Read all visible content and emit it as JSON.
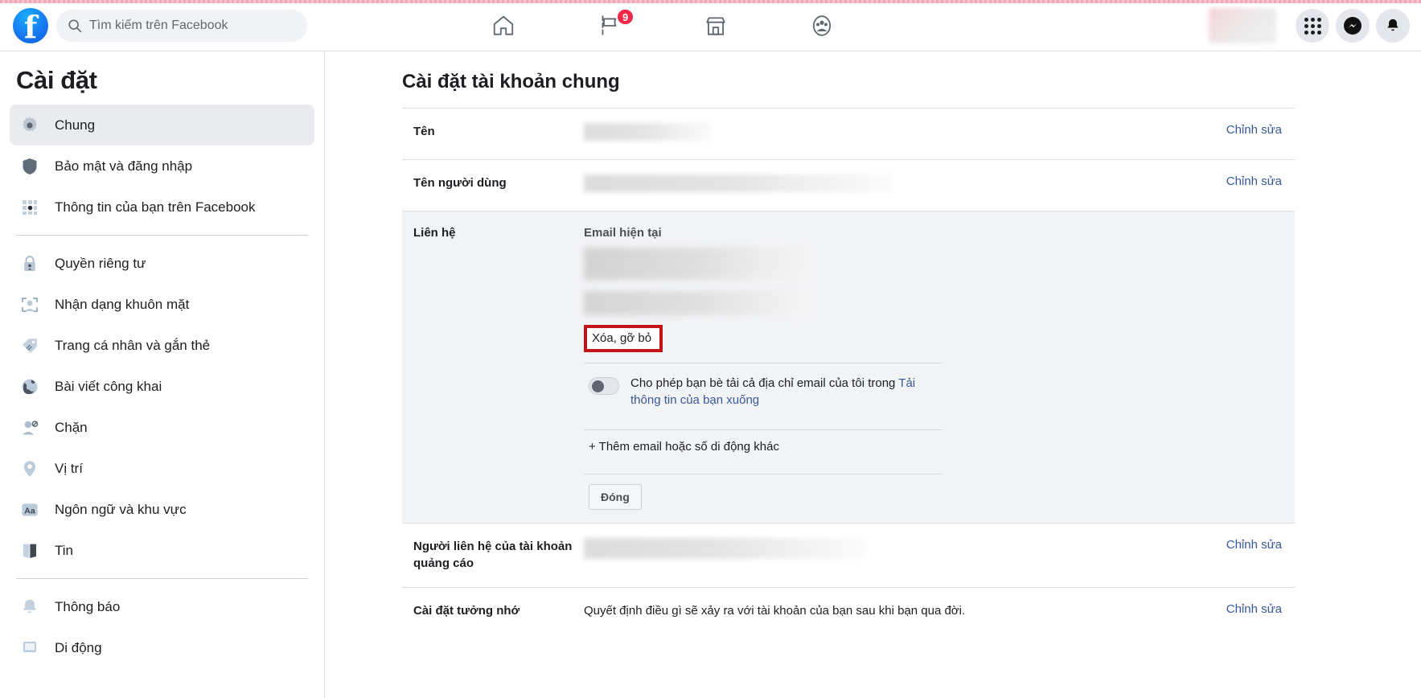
{
  "header": {
    "logo_icon": "facebook-logo-icon",
    "search": {
      "icon": "search-icon",
      "placeholder": "Tìm kiếm trên Facebook",
      "value": ""
    },
    "nav": [
      {
        "name": "home",
        "icon": "home-icon",
        "badge": ""
      },
      {
        "name": "pages",
        "icon": "flag-icon",
        "badge": "9"
      },
      {
        "name": "marketplace",
        "icon": "marketplace-icon",
        "badge": ""
      },
      {
        "name": "groups",
        "icon": "groups-icon",
        "badge": ""
      }
    ],
    "right": [
      {
        "name": "profile-chip",
        "icon": "profile-avatar-icon"
      },
      {
        "name": "menu",
        "icon": "grid-menu-icon"
      },
      {
        "name": "messenger",
        "icon": "messenger-icon"
      },
      {
        "name": "notifications",
        "icon": "bell-icon"
      }
    ]
  },
  "sidebar": {
    "title": "Cài đặt",
    "groups": [
      {
        "items": [
          {
            "label": "Chung",
            "icon": "gear-icon",
            "active": true
          },
          {
            "label": "Bảo mật và đăng nhập",
            "icon": "shield-icon",
            "active": false
          },
          {
            "label": "Thông tin của bạn trên Facebook",
            "icon": "grid-dots-icon",
            "active": false
          }
        ]
      },
      {
        "items": [
          {
            "label": "Quyền riêng tư",
            "icon": "lock-icon",
            "active": false
          },
          {
            "label": "Nhận dạng khuôn mặt",
            "icon": "face-recognition-icon",
            "active": false
          },
          {
            "label": "Trang cá nhân và gắn thẻ",
            "icon": "tag-icon",
            "active": false
          },
          {
            "label": "Bài viết công khai",
            "icon": "globe-icon",
            "active": false
          },
          {
            "label": "Chặn",
            "icon": "block-user-icon",
            "active": false
          },
          {
            "label": "Vị trí",
            "icon": "location-pin-icon",
            "active": false
          },
          {
            "label": "Ngôn ngữ và khu vực",
            "icon": "language-aa-icon",
            "active": false
          },
          {
            "label": "Tin",
            "icon": "stories-book-icon",
            "active": false
          }
        ]
      },
      {
        "items": [
          {
            "label": "Thông báo",
            "icon": "bell-icon",
            "active": false
          },
          {
            "label": "Di động",
            "icon": "mobile-icon",
            "active": false
          }
        ]
      }
    ]
  },
  "main": {
    "title": "Cài đặt tài khoản chung",
    "edit_label": "Chỉnh sửa",
    "rows": [
      {
        "label": "Tên",
        "value": "",
        "redacted": true,
        "edit": "Chỉnh sửa"
      },
      {
        "label": "Tên người dùng",
        "value": "",
        "redacted": true,
        "edit": "Chỉnh sửa"
      }
    ],
    "contact_panel": {
      "label": "Liên hệ",
      "sub_label": "Email hiện tại",
      "email_primary": "",
      "email_secondary": "",
      "remove_link": "Xóa, gỡ bỏ",
      "remove_link_highlighted": true,
      "highlight_color": "#c0131a",
      "toggle": {
        "state": "off",
        "text_before": "Cho phép bạn bè tải cả địa chỉ email của tôi trong ",
        "link_text": "Tải thông tin của bạn xuống",
        "text_after": ""
      },
      "add_link": "+ Thêm email hoặc số di động khác",
      "close_button": "Đóng"
    },
    "bottom_rows": [
      {
        "label": "Người liên hệ của tài khoản quảng cáo",
        "value": "",
        "redacted": true,
        "edit": "Chỉnh sửa"
      },
      {
        "label": "Cài đặt tưởng nhớ",
        "value": "Quyết định điều gì sẽ xảy ra với tài khoản của bạn sau khi bạn qua đời.",
        "redacted": false,
        "edit": "Chỉnh sửa"
      }
    ]
  }
}
